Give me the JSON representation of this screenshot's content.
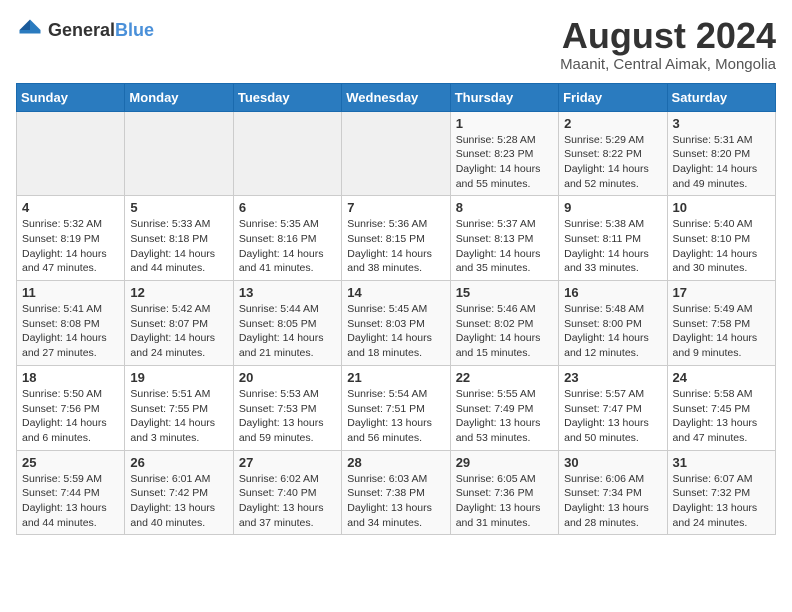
{
  "logo": {
    "general": "General",
    "blue": "Blue"
  },
  "title": {
    "month_year": "August 2024",
    "location": "Maanit, Central Aimak, Mongolia"
  },
  "days_of_week": [
    "Sunday",
    "Monday",
    "Tuesday",
    "Wednesday",
    "Thursday",
    "Friday",
    "Saturday"
  ],
  "weeks": [
    [
      {
        "day": "",
        "info": ""
      },
      {
        "day": "",
        "info": ""
      },
      {
        "day": "",
        "info": ""
      },
      {
        "day": "",
        "info": ""
      },
      {
        "day": "1",
        "info": "Sunrise: 5:28 AM\nSunset: 8:23 PM\nDaylight: 14 hours\nand 55 minutes."
      },
      {
        "day": "2",
        "info": "Sunrise: 5:29 AM\nSunset: 8:22 PM\nDaylight: 14 hours\nand 52 minutes."
      },
      {
        "day": "3",
        "info": "Sunrise: 5:31 AM\nSunset: 8:20 PM\nDaylight: 14 hours\nand 49 minutes."
      }
    ],
    [
      {
        "day": "4",
        "info": "Sunrise: 5:32 AM\nSunset: 8:19 PM\nDaylight: 14 hours\nand 47 minutes."
      },
      {
        "day": "5",
        "info": "Sunrise: 5:33 AM\nSunset: 8:18 PM\nDaylight: 14 hours\nand 44 minutes."
      },
      {
        "day": "6",
        "info": "Sunrise: 5:35 AM\nSunset: 8:16 PM\nDaylight: 14 hours\nand 41 minutes."
      },
      {
        "day": "7",
        "info": "Sunrise: 5:36 AM\nSunset: 8:15 PM\nDaylight: 14 hours\nand 38 minutes."
      },
      {
        "day": "8",
        "info": "Sunrise: 5:37 AM\nSunset: 8:13 PM\nDaylight: 14 hours\nand 35 minutes."
      },
      {
        "day": "9",
        "info": "Sunrise: 5:38 AM\nSunset: 8:11 PM\nDaylight: 14 hours\nand 33 minutes."
      },
      {
        "day": "10",
        "info": "Sunrise: 5:40 AM\nSunset: 8:10 PM\nDaylight: 14 hours\nand 30 minutes."
      }
    ],
    [
      {
        "day": "11",
        "info": "Sunrise: 5:41 AM\nSunset: 8:08 PM\nDaylight: 14 hours\nand 27 minutes."
      },
      {
        "day": "12",
        "info": "Sunrise: 5:42 AM\nSunset: 8:07 PM\nDaylight: 14 hours\nand 24 minutes."
      },
      {
        "day": "13",
        "info": "Sunrise: 5:44 AM\nSunset: 8:05 PM\nDaylight: 14 hours\nand 21 minutes."
      },
      {
        "day": "14",
        "info": "Sunrise: 5:45 AM\nSunset: 8:03 PM\nDaylight: 14 hours\nand 18 minutes."
      },
      {
        "day": "15",
        "info": "Sunrise: 5:46 AM\nSunset: 8:02 PM\nDaylight: 14 hours\nand 15 minutes."
      },
      {
        "day": "16",
        "info": "Sunrise: 5:48 AM\nSunset: 8:00 PM\nDaylight: 14 hours\nand 12 minutes."
      },
      {
        "day": "17",
        "info": "Sunrise: 5:49 AM\nSunset: 7:58 PM\nDaylight: 14 hours\nand 9 minutes."
      }
    ],
    [
      {
        "day": "18",
        "info": "Sunrise: 5:50 AM\nSunset: 7:56 PM\nDaylight: 14 hours\nand 6 minutes."
      },
      {
        "day": "19",
        "info": "Sunrise: 5:51 AM\nSunset: 7:55 PM\nDaylight: 14 hours\nand 3 minutes."
      },
      {
        "day": "20",
        "info": "Sunrise: 5:53 AM\nSunset: 7:53 PM\nDaylight: 13 hours\nand 59 minutes."
      },
      {
        "day": "21",
        "info": "Sunrise: 5:54 AM\nSunset: 7:51 PM\nDaylight: 13 hours\nand 56 minutes."
      },
      {
        "day": "22",
        "info": "Sunrise: 5:55 AM\nSunset: 7:49 PM\nDaylight: 13 hours\nand 53 minutes."
      },
      {
        "day": "23",
        "info": "Sunrise: 5:57 AM\nSunset: 7:47 PM\nDaylight: 13 hours\nand 50 minutes."
      },
      {
        "day": "24",
        "info": "Sunrise: 5:58 AM\nSunset: 7:45 PM\nDaylight: 13 hours\nand 47 minutes."
      }
    ],
    [
      {
        "day": "25",
        "info": "Sunrise: 5:59 AM\nSunset: 7:44 PM\nDaylight: 13 hours\nand 44 minutes."
      },
      {
        "day": "26",
        "info": "Sunrise: 6:01 AM\nSunset: 7:42 PM\nDaylight: 13 hours\nand 40 minutes."
      },
      {
        "day": "27",
        "info": "Sunrise: 6:02 AM\nSunset: 7:40 PM\nDaylight: 13 hours\nand 37 minutes."
      },
      {
        "day": "28",
        "info": "Sunrise: 6:03 AM\nSunset: 7:38 PM\nDaylight: 13 hours\nand 34 minutes."
      },
      {
        "day": "29",
        "info": "Sunrise: 6:05 AM\nSunset: 7:36 PM\nDaylight: 13 hours\nand 31 minutes."
      },
      {
        "day": "30",
        "info": "Sunrise: 6:06 AM\nSunset: 7:34 PM\nDaylight: 13 hours\nand 28 minutes."
      },
      {
        "day": "31",
        "info": "Sunrise: 6:07 AM\nSunset: 7:32 PM\nDaylight: 13 hours\nand 24 minutes."
      }
    ]
  ]
}
